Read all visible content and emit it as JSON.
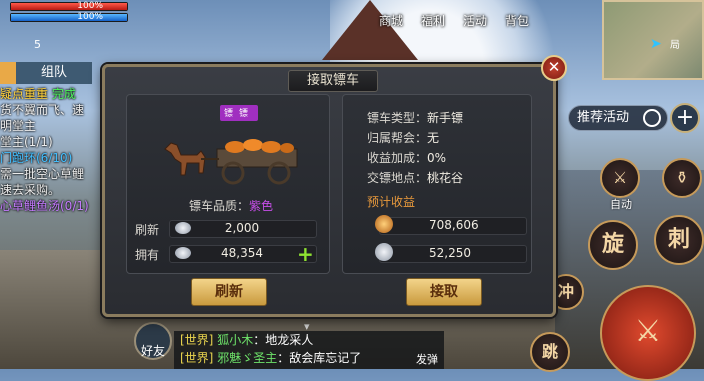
{
  "hud": {
    "hp_text": "100%",
    "mp_text": "100%",
    "hp_fraction": 1.0,
    "mp_fraction": 1.0,
    "level": "5"
  },
  "top_menu": [
    {
      "label": "商城"
    },
    {
      "label": "福利"
    },
    {
      "label": "活动"
    },
    {
      "label": "背包"
    }
  ],
  "minimap": {
    "label": "局"
  },
  "team": {
    "label": "组队"
  },
  "quests": [
    {
      "text": "疑点重重",
      "extra": "完成",
      "style": "title"
    },
    {
      "text": "货不翼而飞、速",
      "style": "normal"
    },
    {
      "text": "明堂主",
      "style": "normal"
    },
    {
      "text": "堂主(1/1)",
      "style": "normal"
    },
    {
      "text": "门跑环(6/10)",
      "style": "loop"
    },
    {
      "text": "需一批空心草鲤",
      "style": "normal"
    },
    {
      "text": "速去采购。",
      "style": "normal"
    },
    {
      "text": "心草鲤鱼汤(0/1)",
      "style": "fish"
    }
  ],
  "right_hud": {
    "recommend_label": "推荐活动",
    "auto_label": "自动",
    "skill_1": "旋",
    "skill_2": "刺",
    "skill_3": "冲",
    "skill_4": "跳"
  },
  "chat": {
    "friend_label": "好友",
    "send_label": "发弹",
    "lines": [
      {
        "channel": "[世界]",
        "name": "狐小木",
        "text": "：地龙采人"
      },
      {
        "channel": "[世界]",
        "name": "邪魅ゞ圣主",
        "text": "：敌会库忘记了"
      }
    ]
  },
  "dialog": {
    "title": "接取镖车",
    "close_label": "✕",
    "cart_tag": "镖镖",
    "quality_label": "镖车品质：",
    "quality_value": "紫色",
    "refresh_label": "刷新",
    "refresh_cost": "2,000",
    "own_label": "拥有",
    "own_amount": "48,354",
    "add_label": "+",
    "info": [
      {
        "label": "镖车类型：",
        "value": "新手镖"
      },
      {
        "label": "归属帮会：",
        "value": "无"
      },
      {
        "label": "收益加成：",
        "value": "0%"
      },
      {
        "label": "交镖地点：",
        "value": "桃花谷"
      }
    ],
    "expected_label": "预计收益",
    "reward_gold": "708,606",
    "reward_silver": "52,250",
    "refresh_button": "刷新",
    "accept_button": "接取"
  },
  "colors": {
    "quality_purple": "#c64ee8",
    "expected_orange": "#e99a3c",
    "button_gold": "#f3d48a"
  }
}
